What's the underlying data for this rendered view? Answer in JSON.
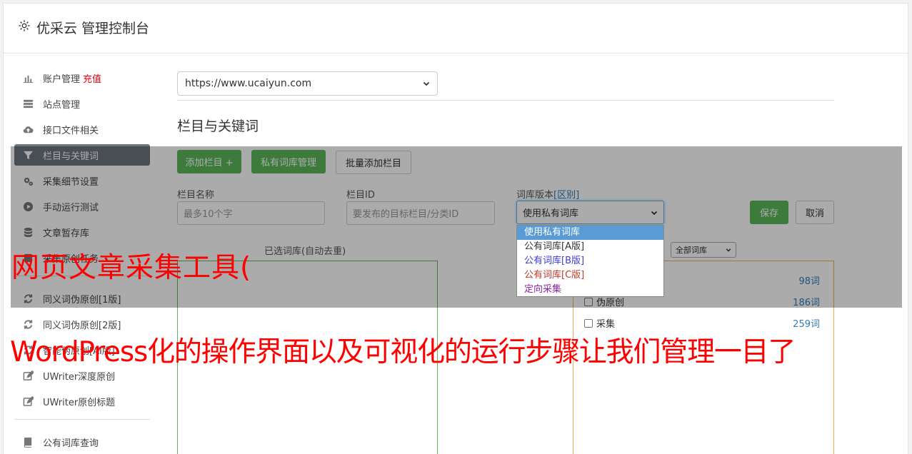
{
  "header": {
    "title": "优采云 管理控制台",
    "icon": "gear-icon"
  },
  "sidebar": {
    "items": [
      {
        "label": "账户管理",
        "badge": "充值",
        "icon": "bar-chart-icon"
      },
      {
        "label": "站点管理",
        "icon": "server-icon"
      },
      {
        "label": "接口文件相关",
        "icon": "cloud-upload-icon"
      },
      {
        "label": "栏目与关键词",
        "icon": "filter-icon",
        "active": true
      },
      {
        "label": "采集细节设置",
        "icon": "cogs-icon"
      },
      {
        "label": "手动运行测试",
        "icon": "play-circle-icon"
      },
      {
        "label": "文章暂存库",
        "icon": "database-icon"
      },
      {
        "label": "采集原创任务",
        "icon": "task-icon"
      },
      {
        "label": "同义词伪原创[1版]",
        "icon": "refresh-icon"
      },
      {
        "label": "同义词伪原创[2版]",
        "icon": "refresh-icon"
      },
      {
        "label": "智能伪原创[AI版]",
        "icon": "refresh-icon"
      },
      {
        "label": "UWriter深度原创",
        "icon": "edit-icon"
      },
      {
        "label": "UWriter原创标题",
        "icon": "edit-icon"
      },
      {
        "label": "公有词库查询",
        "icon": "book-icon"
      }
    ]
  },
  "main": {
    "site_select": "https://www.ucaiyun.com",
    "section_title": "栏目与关键词",
    "buttons": {
      "add_column": "添加栏目 +",
      "private_lib": "私有词库管理",
      "batch_add": "批量添加栏目",
      "save": "保存",
      "cancel": "取消"
    },
    "fields": {
      "column_name_label": "栏目名称",
      "column_name_placeholder": "最多10个字",
      "column_id_label": "栏目ID",
      "column_id_placeholder": "要发布的目标栏目/分类ID",
      "lib_version_label": "词库版本",
      "lib_version_link": "[区别]",
      "lib_version_value": "使用私有词库"
    },
    "dropdown_options": [
      {
        "label": "使用私有词库",
        "selected": true,
        "color": "#ffffff"
      },
      {
        "label": "公有词库[A版]",
        "color": "#333333"
      },
      {
        "label": "公有词库[B版]",
        "color": "#3b3bd6"
      },
      {
        "label": "公有词库[C版]",
        "color": "#c0392b"
      },
      {
        "label": "定向采集",
        "color": "#8e24aa"
      }
    ],
    "selected_lib_label": "已选词库(自动去重)",
    "all_lib_select": "全部词库",
    "lib_list": [
      {
        "label": "",
        "count": "98词"
      },
      {
        "label": "伪原创",
        "count": "186词"
      },
      {
        "label": "采集",
        "count": "259词"
      }
    ]
  },
  "captions": {
    "line1": "网页文章采集工具(",
    "line2": "WordPress化的操作界面以及可视化的运行步骤让我们管理一目了"
  },
  "colors": {
    "accent": "#5cb85c",
    "active_nav": "#6c757d",
    "caption": "#ff0000",
    "link": "#337ab7"
  }
}
